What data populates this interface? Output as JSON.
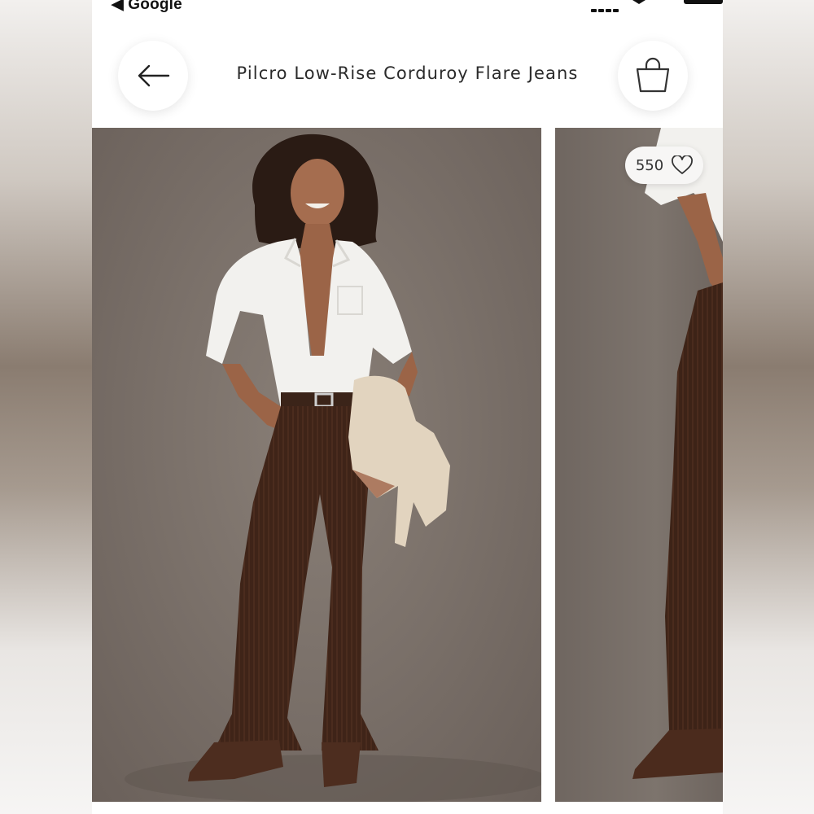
{
  "status_bar": {
    "back_app": "◀ Google"
  },
  "header": {
    "title": "Pilcro Low-Rise Corduroy Flare Jeans",
    "back_icon": "arrow-left-icon",
    "bag_icon": "shopping-bag-icon"
  },
  "gallery": {
    "like_count": "550",
    "like_icon": "heart-outline-icon"
  },
  "colors": {
    "corduroy_brown": "#3e2417",
    "background_taupe": "#7a7069",
    "shirt_white": "#f2f1ee"
  }
}
